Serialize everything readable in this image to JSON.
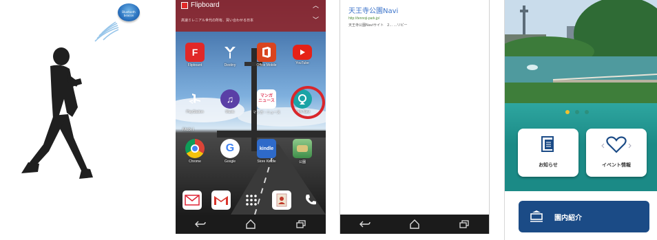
{
  "beacon": {
    "label_line1": "Bluetooth",
    "label_line2": "beacon"
  },
  "phone1": {
    "notification": {
      "app": "Flipboard",
      "text": "高速ミレニアル世代の所有、買い合わせる日本"
    },
    "folder_label": "Mobi I",
    "apps": [
      {
        "label": "Flipboard",
        "icon": "flipboard-icon",
        "color": "#e12828"
      },
      {
        "label": "Destiny",
        "icon": "destiny-icon",
        "color": "#2f3b4a"
      },
      {
        "label": "Office Mobile",
        "icon": "office-icon",
        "color": "#d9441f"
      },
      {
        "label": "YouTube",
        "icon": "youtube-icon",
        "color": "#e62117"
      },
      {
        "label": "PlayStation",
        "icon": "playstation-icon",
        "color": "#1b3f8f"
      },
      {
        "label": "Music",
        "icon": "music-icon",
        "color": "#5a3fa6"
      },
      {
        "label": "マンガ・ニュース",
        "icon": "manga-news-icon",
        "color": "#e03a5a"
      },
      {
        "label": "Park Navi",
        "icon": "park-navi-icon",
        "color": "#1aa3a6"
      },
      {
        "label": "Chrome",
        "icon": "chrome-icon",
        "color": "#ffffff"
      },
      {
        "label": "Google",
        "icon": "google-icon",
        "color": "#ffffff"
      },
      {
        "label": "Store Kindle",
        "icon": "kindle-icon",
        "color": "#2e6ac9"
      },
      {
        "label": "公園",
        "icon": "park-map-icon",
        "color": "#3f8e4a"
      },
      {
        "label": "",
        "icon": "gmail-envelope-icon",
        "color": "#ffffff"
      },
      {
        "label": "",
        "icon": "gmail-icon",
        "color": "#ffffff"
      },
      {
        "label": "",
        "icon": "app-drawer-icon",
        "color": "#333333"
      },
      {
        "label": "",
        "icon": "contacts-icon",
        "color": "#ffffff"
      },
      {
        "label": "",
        "icon": "phone-icon",
        "color": "#ffffff"
      }
    ]
  },
  "phone2": {
    "title": "天王寺公園Navi",
    "url": "http://tennoji-park.jp/",
    "snippet": "天王寺公園Naviサイト　2... ...リピー"
  },
  "phone3": {
    "tiles": [
      {
        "label": "お知らせ",
        "icon": "news-document-icon"
      },
      {
        "label": "イベント情報",
        "icon": "heart-icon"
      }
    ],
    "intro_button": "園内紹介",
    "accent": "#1b8a86",
    "button_color": "#1b4b86"
  }
}
